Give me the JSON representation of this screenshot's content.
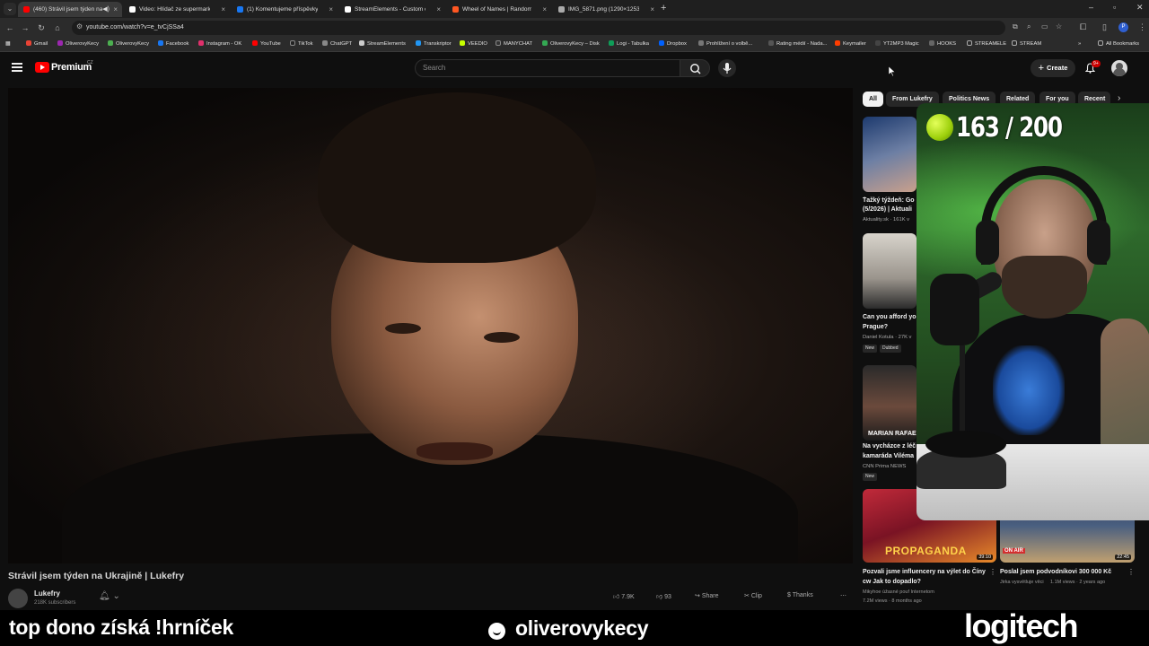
{
  "browser": {
    "tabs": [
      {
        "label": "(460) Strávil jsem týden na ",
        "active": true,
        "color": "#ff0000"
      },
      {
        "label": "Video: Hlídač ze supermarketu",
        "active": false,
        "color": "#ffffff"
      },
      {
        "label": "(1) Komentujeme příspěvky de",
        "active": false,
        "color": "#1877f2"
      },
      {
        "label": "StreamElements - Custom com",
        "active": false,
        "color": "#ffffff"
      },
      {
        "label": "Wheel of Names | Random nam",
        "active": false,
        "color": "#ff5722"
      },
      {
        "label": "IMG_5871.png (1290×1253)",
        "active": false,
        "color": "#aaaaaa"
      }
    ],
    "url": "youtube.com/watch?v=e_tvCjSSa4",
    "profile_initial": "P",
    "bookmarks": [
      "Gmail",
      "OliverovyKecy",
      "OliverovyKecy",
      "Facebook",
      "Instagram - OK",
      "YouTube",
      "TikTok",
      "ChatGPT",
      "StreamElements",
      "Transkriptor",
      "VEEDIO",
      "MANYCHAT",
      "OliverovyKecy – Disk",
      "Logi - Tabulka",
      "Dropbox",
      "Prohlížení o volbě...",
      "Rating médií - Nada...",
      "Keymailer",
      "YT2MP3 Magic",
      "HOOKS",
      "STREAMELE",
      "STREAM"
    ],
    "all_bookmarks": "All Bookmarks"
  },
  "youtube": {
    "logo_text": "Premium",
    "region": "CZ",
    "search_placeholder": "Search",
    "create_label": "Create",
    "notif_count": "9+",
    "video": {
      "title": "Strávil jsem týden na Ukrajině | Lukefry",
      "channel": "Lukefry",
      "subscribers": "218K subscribers",
      "likes": "7.9K",
      "dislikes": "93",
      "share": "Share",
      "clip": "Clip",
      "thanks": "Thanks"
    },
    "chips": [
      "All",
      "From Lukefry",
      "Politics News",
      "Related",
      "For you",
      "Recent"
    ],
    "recommended": [
      {
        "title1": "Ťažký týždeň: Go",
        "title2": "(5/2026) | Aktuali",
        "meta": "Aktuality.sk · 161K v",
        "badge": ""
      },
      {
        "title1": "Can you afford yo",
        "title2": "Prague?",
        "meta": "Daniel Kotula · 27K v",
        "badge": "New",
        "badge2": "Dubbed"
      },
      {
        "title1": "Na vycházce z léč",
        "title2": "kamaráda Viléma",
        "meta": "CNN Prima NEWS",
        "badge": "New",
        "thumb_text": "MARIAN RAFAE"
      }
    ],
    "bottom_videos": [
      {
        "title": "Pozvali jsme influencery na výlet do Číny cw Jak to dopadlo?",
        "meta": "Mikyhoe úžasné pouf Internetom",
        "views": "7.2M views · 8 months ago",
        "duration": "39:10",
        "thumb_text": "PROPAGANDA"
      },
      {
        "title": "Poslal jsem podvodníkovi 300 000 Kč",
        "meta": "Jirka vysvětluje věci",
        "views": "1.1M views · 2 years ago",
        "duration": "22:45",
        "thumb_text": "ON AIR"
      }
    ]
  },
  "stream_overlay": {
    "counter": "163 / 200",
    "left_text": "top dono získá !hrníček",
    "handle": "oliverovykecy",
    "sponsor": "logitech"
  }
}
